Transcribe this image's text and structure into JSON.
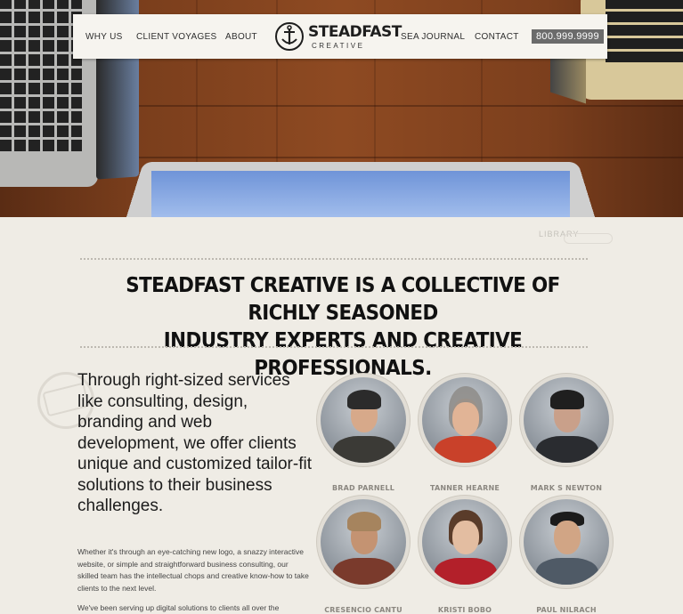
{
  "nav": {
    "items": [
      "WHY US",
      "CLIENT VOYAGES",
      "ABOUT",
      "SEA JOURNAL",
      "CONTACT"
    ],
    "logo": {
      "name": "STEADFAST",
      "sub": "CREATIVE",
      "icon": "anchor-icon"
    },
    "phone": "800.999.9999"
  },
  "stamp": "LIBRARY",
  "headline": {
    "line1": "STEADFAST CREATIVE IS A COLLECTIVE OF RICHLY SEASONED",
    "line2": "INDUSTRY EXPERTS AND CREATIVE PROFESSIONALS."
  },
  "intro": {
    "lead": "Through right-sized services like consulting, design, branding and web development, we offer clients unique and customized tailor-fit solutions to their business challenges.",
    "para1": "Whether it's through an eye-catching new logo, a snazzy interactive website, or simple and straightforward business consulting, our skilled team has the intellectual chops and creative know-how to take clients to the next level.",
    "para2": "We've been serving up digital solutions to clients all over the"
  },
  "team": [
    {
      "name": "BRAD PARNELL"
    },
    {
      "name": "TANNER HEARNE"
    },
    {
      "name": "MARK S NEWTON"
    },
    {
      "name": "CRESENCIO CANTU"
    },
    {
      "name": "KRISTI BOBO"
    },
    {
      "name": "PAUL NILRACH"
    }
  ],
  "colors": {
    "page_bg": "#efece5",
    "nav_bg": "#f6f4ef",
    "phone_bg": "#6b6b6b",
    "headline": "#111111",
    "name_text": "#8b8780"
  }
}
